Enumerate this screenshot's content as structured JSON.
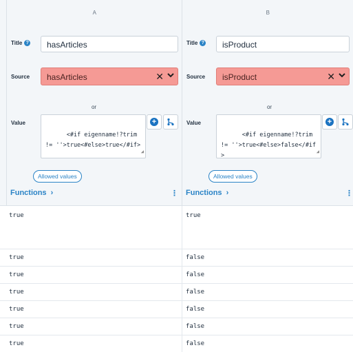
{
  "columns": [
    {
      "header": "A",
      "title_label": "Title",
      "title_value": "hasArticles",
      "source_label": "Source",
      "source_value": "hasArticles",
      "or_label": "or",
      "value_label": "Value",
      "value_text": "<#if eigenname!?trim != ''>true<#else>true</#if>",
      "allowed_values_label": "Allowed values",
      "functions_label": "Functions"
    },
    {
      "header": "B",
      "title_label": "Title",
      "title_value": "isProduct",
      "source_label": "Source",
      "source_value": "isProduct",
      "or_label": "or",
      "value_label": "Value",
      "value_text": "<#if eigenname!?trim != ''>true<#else>false</#if>",
      "allowed_values_label": "Allowed values",
      "functions_label": "Functions"
    }
  ],
  "icons": {
    "help": "help-circle-icon",
    "clear": "close-icon",
    "chevron": "chevron-down-icon",
    "add": "plus-circle-icon",
    "branch": "branch-icon",
    "functions_arrow": "chevron-right-icon",
    "menu": "kebab-menu-icon"
  },
  "colors": {
    "accent": "#2a83c6",
    "source_error_bg": "#f59a95",
    "panel_bg": "#f3f6f9"
  },
  "rows": [
    {
      "a": "true",
      "b": "true"
    },
    {
      "a": "true",
      "b": "false"
    },
    {
      "a": "true",
      "b": "false"
    },
    {
      "a": "true",
      "b": "false"
    },
    {
      "a": "true",
      "b": "false"
    },
    {
      "a": "true",
      "b": "false"
    },
    {
      "a": "true",
      "b": "false"
    }
  ]
}
